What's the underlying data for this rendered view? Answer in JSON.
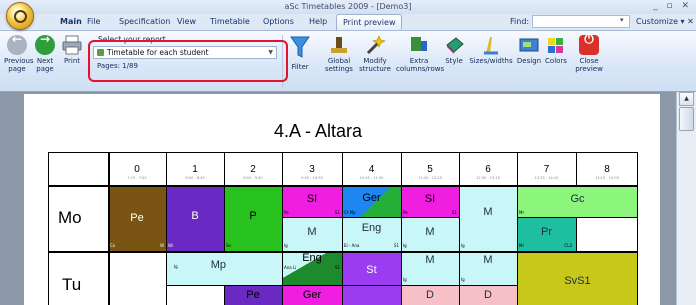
{
  "window": {
    "title": "aSc Timetables 2009 - [Demo3]",
    "controls": "_ ▫ ✕"
  },
  "tabs": [
    "Main",
    "File",
    "Specification",
    "View",
    "Timetable",
    "Options",
    "Help",
    "Print preview"
  ],
  "find": {
    "label": "Find:",
    "value": "",
    "customize": "Customize ▾ ✕"
  },
  "ribbon": {
    "previous_page": "Previous page",
    "next_page": "Next page",
    "print": "Print",
    "select_report_label": "Select your report",
    "selected_report": "Timetable for each student",
    "pages": "Pages: 1/89",
    "filter": "Filter",
    "global_settings": "Global settings",
    "modify_structure": "Modify structure",
    "extra_columns": "Extra columns/rows",
    "style": "Style",
    "sizes_widths": "Sizes/widths",
    "design": "Design",
    "colors": "Colors",
    "close_preview": "Close preview"
  },
  "timetable": {
    "title": "4.A - Altara",
    "periods": [
      "0",
      "1",
      "2",
      "3",
      "4",
      "5",
      "6",
      "7",
      "8"
    ],
    "times": [
      "7:15 - 7:55",
      "8:00 - 8:45",
      "8:55 - 9:40",
      "9:50 - 10:35",
      "10:45 - 11:30",
      "11:40 - 12:25",
      "12:30 - 13:15",
      "13:25 - 14:10",
      "14:15 - 15:00"
    ],
    "days": [
      "Mo",
      "Tu"
    ],
    "lessons": {
      "mo_pe_0": {
        "subject": "Pe",
        "room": "Cx",
        "teacher": "W"
      },
      "mo_b_1": {
        "subject": "B",
        "teacher": "Wi"
      },
      "mo_p_2": {
        "subject": "P",
        "teacher": "Se"
      },
      "mo_si_3": {
        "subject": "SI",
        "a": "Pe",
        "b": "S1"
      },
      "mo_ger_4": {
        "subject": "Ger",
        "teacher": "Ct Mp"
      },
      "mo_si_5": {
        "subject": "SI",
        "a": "Pe",
        "b": "S1"
      },
      "mo_m_3": {
        "subject": "M",
        "teacher": "Ig"
      },
      "mo_eng_4": {
        "subject": "Eng",
        "teacher": "El - Ana",
        "room": "S1"
      },
      "mo_m_5": {
        "subject": "M",
        "teacher": "Ig"
      },
      "mo_m_6": {
        "subject": "M",
        "teacher": "Ig"
      },
      "mo_gc_78": {
        "subject": "Gc",
        "teacher": "Mr"
      },
      "mo_pr_7": {
        "subject": "Pr",
        "teacher": "Mr",
        "room": "CL2"
      },
      "tu_mp_12": {
        "subject": "Mp",
        "teacher": "Ig"
      },
      "tu_eng_3": {
        "subject": "Eng",
        "teacher": "Ana Li",
        "room": "S1"
      },
      "tu_st_4": {
        "subject": "St"
      },
      "tu_m_5": {
        "subject": "M",
        "teacher": "Ig"
      },
      "tu_m_6": {
        "subject": "M",
        "teacher": "Ig"
      },
      "tu_svs1_78": {
        "subject": "SvS1"
      },
      "tu_pe_2": {
        "subject": "Pe"
      },
      "tu_ger_3": {
        "subject": "Ger"
      },
      "tu_d_5": {
        "subject": "D"
      },
      "tu_d_6": {
        "subject": "D"
      }
    }
  },
  "colors": {
    "pe": "#7a5412",
    "b": "#6a29c2",
    "p": "#27c21e",
    "si": "#f01ee1",
    "ger": "#1e86f0",
    "m": "#c9f7f7",
    "eng": "#c9f7f7",
    "gc": "#8cf57c",
    "pr": "#1ebfa0",
    "st": "#9b3cf0",
    "svs1": "#c8c81a",
    "d": "#f7c0c6",
    "mp": "#c9f7f7",
    "eng_tu": "#1e8a2e"
  }
}
